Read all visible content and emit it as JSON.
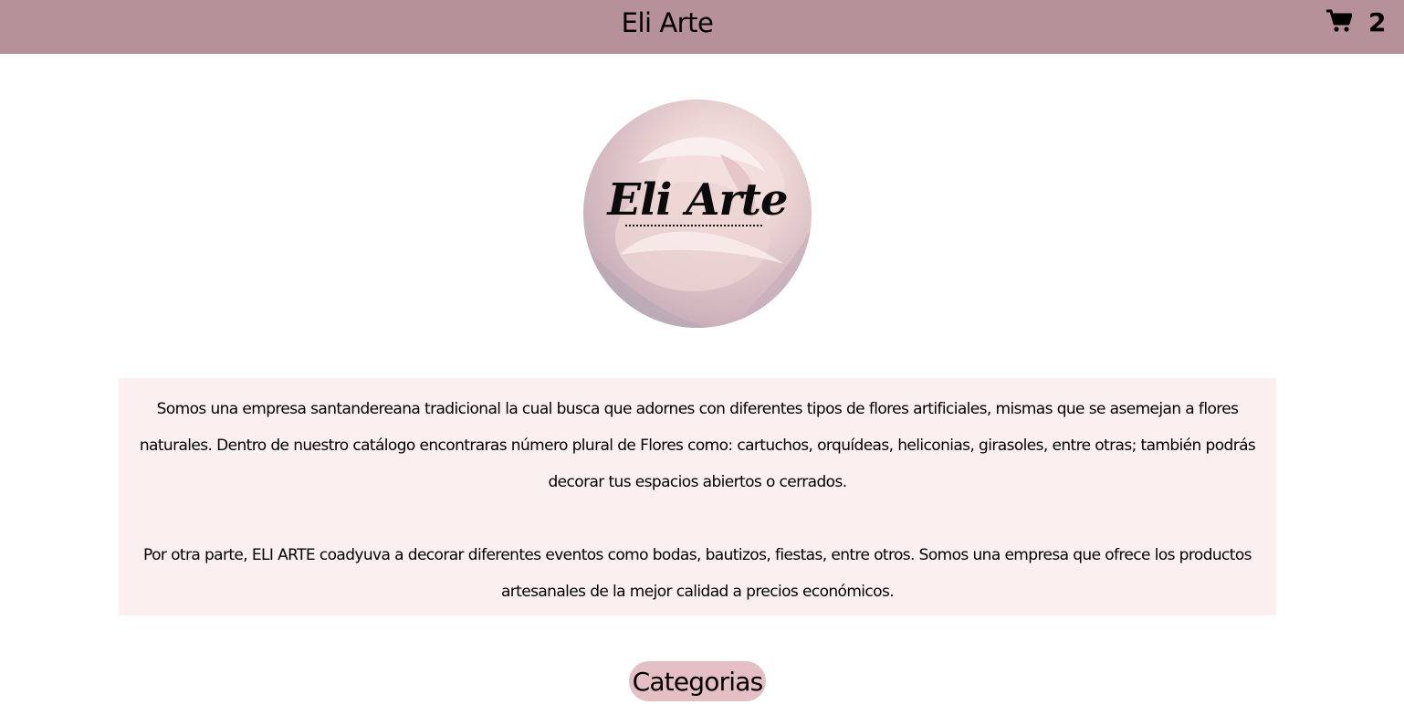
{
  "header": {
    "title": "Eli Arte",
    "cart_icon": "cart-icon",
    "cart_count": "2",
    "background_color": "#b7919a"
  },
  "logo": {
    "text": "Eli Arte",
    "image": "rose-flower-background"
  },
  "about": {
    "paragraph_1": "Somos una empresa santandereana tradicional la cual busca que adornes con diferentes tipos de flores artificiales, mismas que se asemejan a flores naturales. Dentro de nuestro catálogo encontraras número plural de Flores como: cartuchos, orquídeas, heliconias, girasoles, entre otras; también podrás decorar tus espacios abiertos o cerrados.",
    "paragraph_2": "Por otra parte, ELI ARTE coadyuva a decorar diferentes eventos como bodas, bautizos, fiestas, entre otros. Somos una empresa que ofrece los productos artesanales de la mejor calidad a precios económicos.",
    "background_color": "#fbf0ef"
  },
  "categories": {
    "label": "Categorias",
    "background_color": "#e4bfc3"
  }
}
